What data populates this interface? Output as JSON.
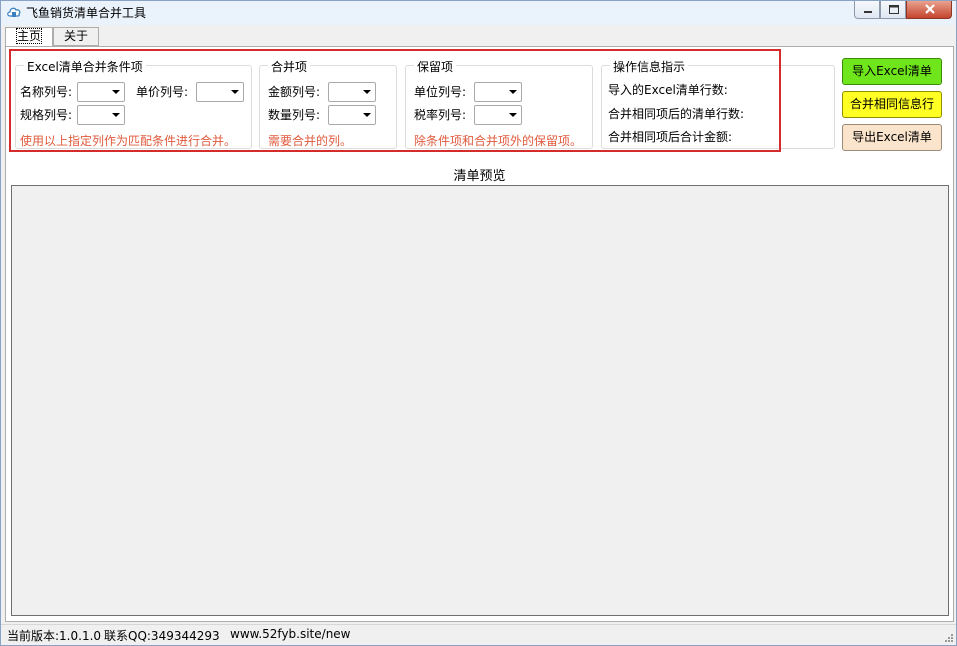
{
  "window": {
    "title": "飞鱼销货清单合并工具"
  },
  "tabs": [
    {
      "label": "主页",
      "active": true
    },
    {
      "label": "关于",
      "active": false
    }
  ],
  "match_group": {
    "title": "Excel清单合并条件项",
    "name_col_label": "名称列号:",
    "price_col_label": "单价列号:",
    "spec_col_label": "规格列号:",
    "hint": "使用以上指定列作为匹配条件进行合并。"
  },
  "merge_group": {
    "title": "合并项",
    "amount_col_label": "金额列号:",
    "qty_col_label": "数量列号:",
    "hint": "需要合并的列。"
  },
  "keep_group": {
    "title": "保留项",
    "unit_col_label": "单位列号:",
    "tax_col_label": "税率列号:",
    "hint": "除条件项和合并项外的保留项。"
  },
  "info_group": {
    "title": "操作信息指示",
    "imported_rows_label": "导入的Excel清单行数:",
    "merged_rows_label": "合并相同项后的清单行数:",
    "merged_total_label": "合并相同项后合计金额:"
  },
  "actions": {
    "import_label": "导入Excel清单",
    "merge_label": "合并相同信息行",
    "export_label": "导出Excel清单"
  },
  "preview": {
    "title": "清单预览"
  },
  "status": {
    "version": "当前版本:1.0.1.0",
    "qq": "联系QQ:349344293",
    "site": "www.52fyb.site/new"
  },
  "colors": {
    "highlight_frame": "#d52b2b",
    "hint_text": "#e05a3c",
    "import_button": "#6fe61c",
    "merge_button": "#ffff24",
    "export_button": "#fbe4cc"
  },
  "icons": {
    "app": "app-cloud-icon",
    "minimize": "minimize-icon",
    "maximize": "maximize-icon",
    "close": "close-icon",
    "dropdown": "chevron-down-icon",
    "grip": "resize-grip-icon"
  }
}
